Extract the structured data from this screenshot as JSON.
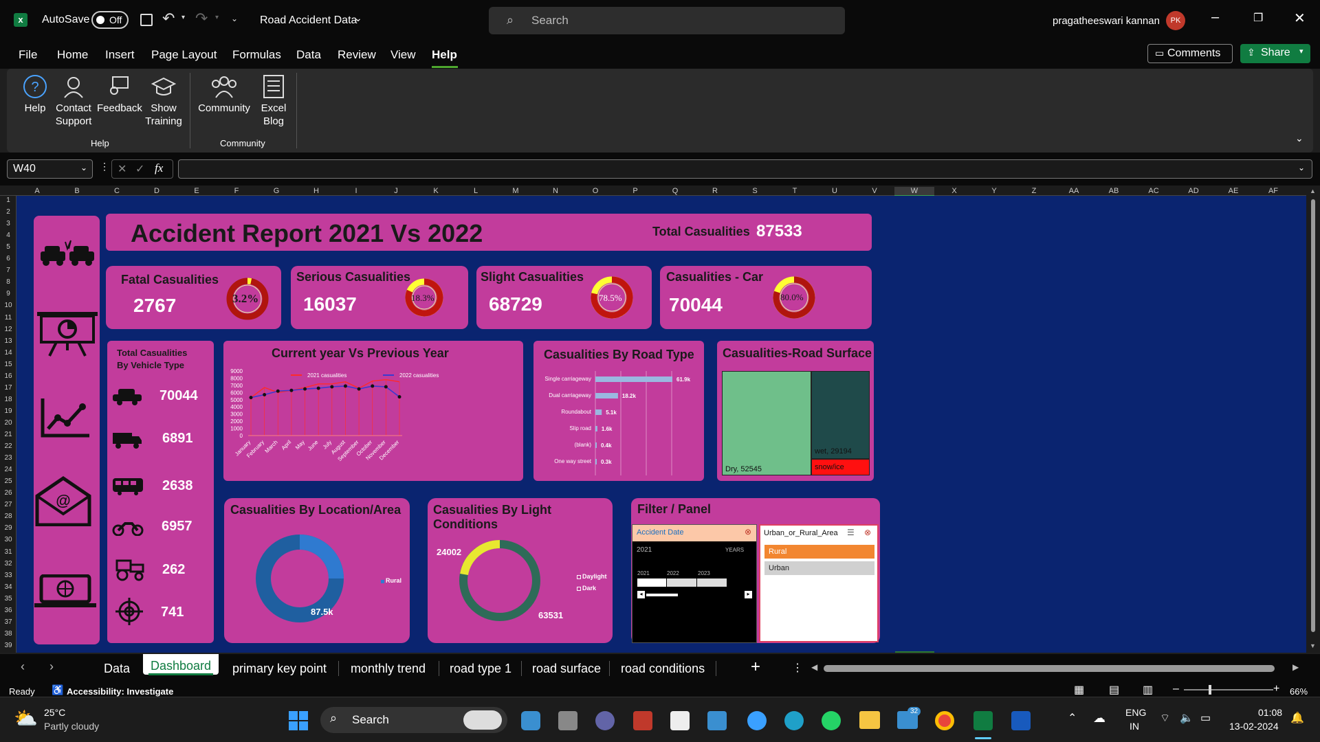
{
  "app": {
    "autosave_label": "AutoSave",
    "autosave_state": "Off",
    "doc_title": "Road Accident Data",
    "search_placeholder": "Search",
    "user_name": "pragatheeswari kannan",
    "user_initials": "PK",
    "comments_label": "Comments",
    "share_label": "Share"
  },
  "menu": [
    "File",
    "Home",
    "Insert",
    "Page Layout",
    "Formulas",
    "Data",
    "Review",
    "View",
    "Help"
  ],
  "ribbon": {
    "help_group_label": "Help",
    "community_group_label": "Community",
    "buttons": [
      {
        "label": "Help",
        "icon": "help-icon"
      },
      {
        "label": "Contact Support",
        "icon": "contact-support-icon"
      },
      {
        "label": "Feedback",
        "icon": "feedback-icon"
      },
      {
        "label": "Show Training",
        "icon": "training-icon"
      },
      {
        "label": "Community",
        "icon": "community-icon"
      },
      {
        "label": "Excel Blog",
        "icon": "blog-icon"
      }
    ]
  },
  "formula_bar": {
    "name_box": "W40",
    "formula": ""
  },
  "columns": [
    "A",
    "B",
    "C",
    "D",
    "E",
    "F",
    "G",
    "H",
    "I",
    "J",
    "K",
    "L",
    "M",
    "N",
    "O",
    "P",
    "Q",
    "R",
    "S",
    "T",
    "U",
    "V",
    "W",
    "X",
    "Y",
    "Z",
    "AA",
    "AB",
    "AC",
    "AD",
    "AE",
    "AF"
  ],
  "rows": [
    "1",
    "2",
    "3",
    "4",
    "5",
    "6",
    "7",
    "8",
    "9",
    "10",
    "11",
    "12",
    "13",
    "14",
    "15",
    "16",
    "17",
    "18",
    "19",
    "20",
    "21",
    "22",
    "23",
    "24",
    "25",
    "26",
    "27",
    "28",
    "29",
    "30",
    "31",
    "32",
    "33",
    "34",
    "35",
    "36",
    "37",
    "38",
    "39"
  ],
  "dashboard": {
    "title": "Accident Report 2021 Vs 2022",
    "total_label": "Total Casualities",
    "total_value": "87533",
    "kpis": [
      {
        "label": "Fatal Casualities",
        "value": "2767",
        "pct": "3.2%",
        "fraction": 0.032
      },
      {
        "label": "Serious Casualities",
        "value": "16037",
        "pct": "18.3%",
        "fraction": 0.183
      },
      {
        "label": "Slight Casualities",
        "value": "68729",
        "pct": "78.5%",
        "fraction": 0.785
      },
      {
        "label": "Casualities - Car",
        "value": "70044",
        "pct": "80.0%",
        "fraction": 0.8
      }
    ],
    "vehicle": {
      "title_line1": "Total Casualities",
      "title_line2": "By Vehicle Type",
      "items": [
        {
          "icon": "car-icon",
          "value": "70044"
        },
        {
          "icon": "truck-icon",
          "value": "6891"
        },
        {
          "icon": "bus-icon",
          "value": "2638"
        },
        {
          "icon": "motorcycle-icon",
          "value": "6957"
        },
        {
          "icon": "tractor-icon",
          "value": "262"
        },
        {
          "icon": "target-icon",
          "value": "741"
        }
      ]
    },
    "line_title": "Current year Vs Previous Year",
    "road_title": "Casualities By Road Type",
    "surface_title": "Casualities-Road Surface",
    "location_title": "Casualities By Location/Area",
    "light_title": "Casualities By Light Conditions",
    "filter_title": "Filter / Panel",
    "slicer_date": {
      "header": "Accident Date",
      "period": "2021",
      "level": "YEARS",
      "years": [
        "2021",
        "2022",
        "2023"
      ]
    },
    "slicer_area": {
      "header": "Urban_or_Rural_Area",
      "items": [
        "Rural",
        "Urban"
      ]
    }
  },
  "chart_data": [
    {
      "type": "line",
      "title": "Current year Vs Previous Year",
      "x": [
        "January",
        "February",
        "March",
        "April",
        "May",
        "June",
        "July",
        "August",
        "September",
        "October",
        "November",
        "December"
      ],
      "ylim": [
        0,
        9000
      ],
      "yticks": [
        "9000",
        "8000",
        "7000",
        "6000",
        "5000",
        "4000",
        "3000",
        "2000",
        "1000",
        "0"
      ],
      "series": [
        {
          "name": "2021 casualities",
          "color": "#ff2a2a",
          "values": [
            5300,
            6700,
            6000,
            6300,
            6700,
            7200,
            7200,
            7500,
            6600,
            7600,
            7800,
            7500
          ]
        },
        {
          "name": "2022 casualities",
          "color": "#3a3ad0",
          "values": [
            5300,
            5700,
            6200,
            6300,
            6500,
            6600,
            6800,
            6900,
            6500,
            6900,
            6800,
            5400
          ]
        }
      ]
    },
    {
      "type": "bar",
      "title": "Casualities By Road Type",
      "categories": [
        "Single carriageway",
        "Dual carriageway",
        "Roundabout",
        "Slip road",
        "(blank)",
        "One way street"
      ],
      "values": [
        61.9,
        18.2,
        5.1,
        1.6,
        0.4,
        0.3
      ],
      "labels": [
        "61.9k",
        "18.2k",
        "5.1k",
        "1.6k",
        "0.4k",
        "0.3k"
      ]
    },
    {
      "type": "heatmap",
      "title": "Casualities-Road Surface",
      "labels": [
        "Dry, 52545",
        "wet, 29194",
        "snow/ice"
      ],
      "values": [
        52545,
        29194,
        null
      ]
    },
    {
      "type": "pie",
      "title": "Casualities By Location/Area",
      "legend": [
        "Rural"
      ],
      "center_label": "87.5k"
    },
    {
      "type": "pie",
      "title": "Casualities By Light Conditions",
      "legend": [
        "Daylight",
        "Dark"
      ],
      "labels": [
        "24002",
        "63531"
      ],
      "values": [
        24002,
        63531
      ]
    }
  ],
  "sheet_tabs": [
    "Data",
    "Dashboard",
    "primary key point",
    "monthly trend",
    "road type 1",
    "road surface",
    "road conditions"
  ],
  "status": {
    "ready": "Ready",
    "accessibility": "Accessibility: Investigate",
    "zoom": "66%"
  },
  "taskbar": {
    "temp": "25°C",
    "weather": "Partly cloudy",
    "search": "Search",
    "lang1": "ENG",
    "lang2": "IN",
    "time": "01:08",
    "date": "13-02-2024",
    "badge": "32"
  }
}
